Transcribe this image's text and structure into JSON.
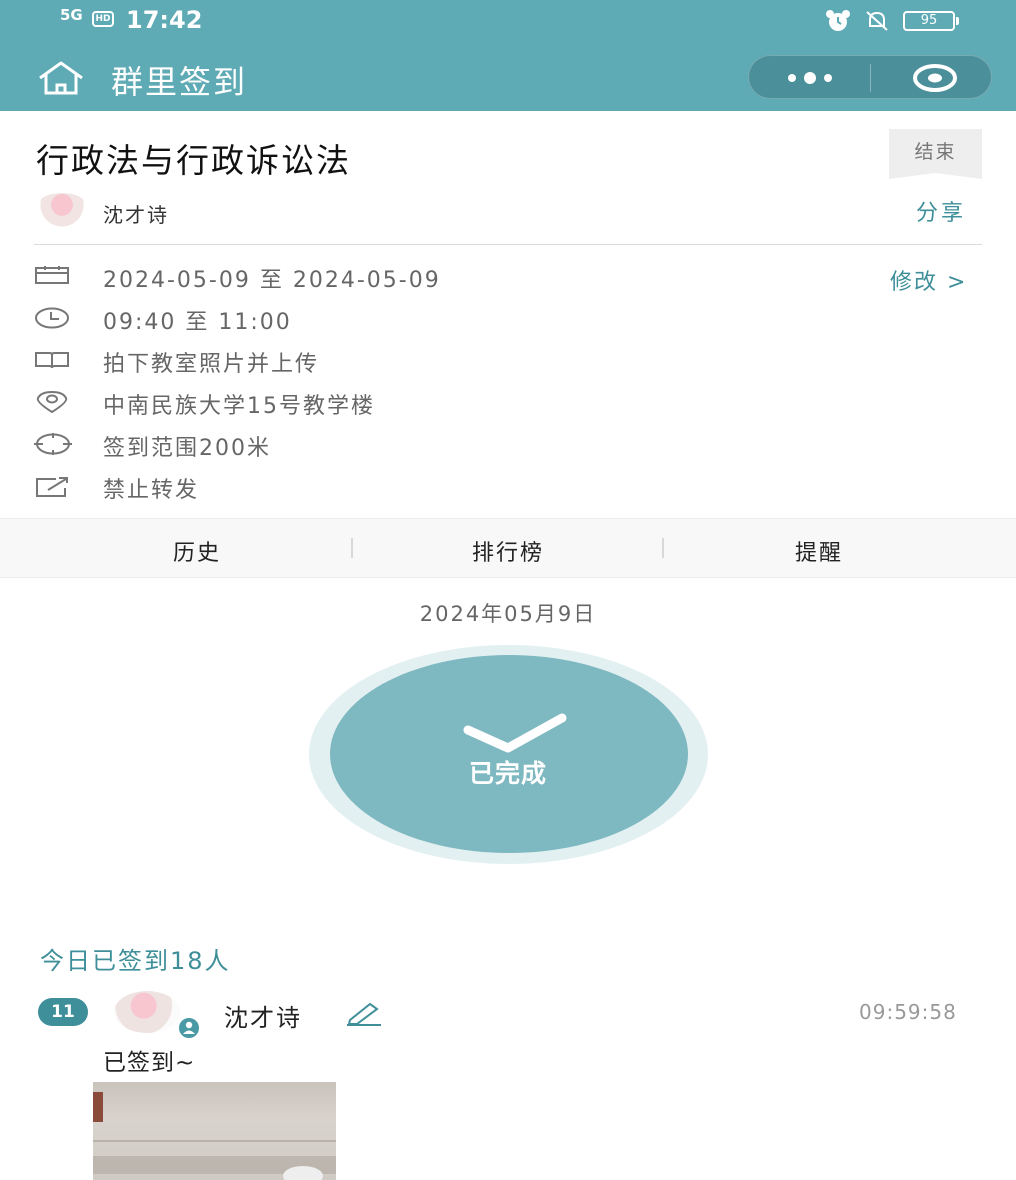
{
  "status_bar": {
    "network": "5G",
    "hd": "HD",
    "time": "17:42",
    "battery": "95"
  },
  "nav": {
    "title": "群里签到"
  },
  "event": {
    "title": "行政法与行政诉讼法",
    "status_badge": "结束",
    "creator": "沈才诗",
    "share_label": "分享",
    "edit_label": "修改 >",
    "info": {
      "date_range": "2024-05-09 至 2024-05-09",
      "time_range": "09:40 至 11:00",
      "task": "拍下教室照片并上传",
      "location": "中南民族大学15号教学楼",
      "range": "签到范围200米",
      "forward": "禁止转发"
    },
    "icons": [
      "calendar-icon",
      "clock-icon",
      "book-icon",
      "location-icon",
      "crosshair-icon",
      "share-box-icon"
    ]
  },
  "tabs": [
    "历史",
    "排行榜",
    "提醒"
  ],
  "checkin": {
    "date": "2024年05月9日",
    "status": "已完成",
    "summary": "今日已签到18人"
  },
  "entries": [
    {
      "rank": "11",
      "name": "沈才诗",
      "time": "09:59:58",
      "message": "已签到~"
    }
  ],
  "colors": {
    "brand": "#5eaab5",
    "accent": "#3f8f9a",
    "disk": "#7eb8c1"
  }
}
